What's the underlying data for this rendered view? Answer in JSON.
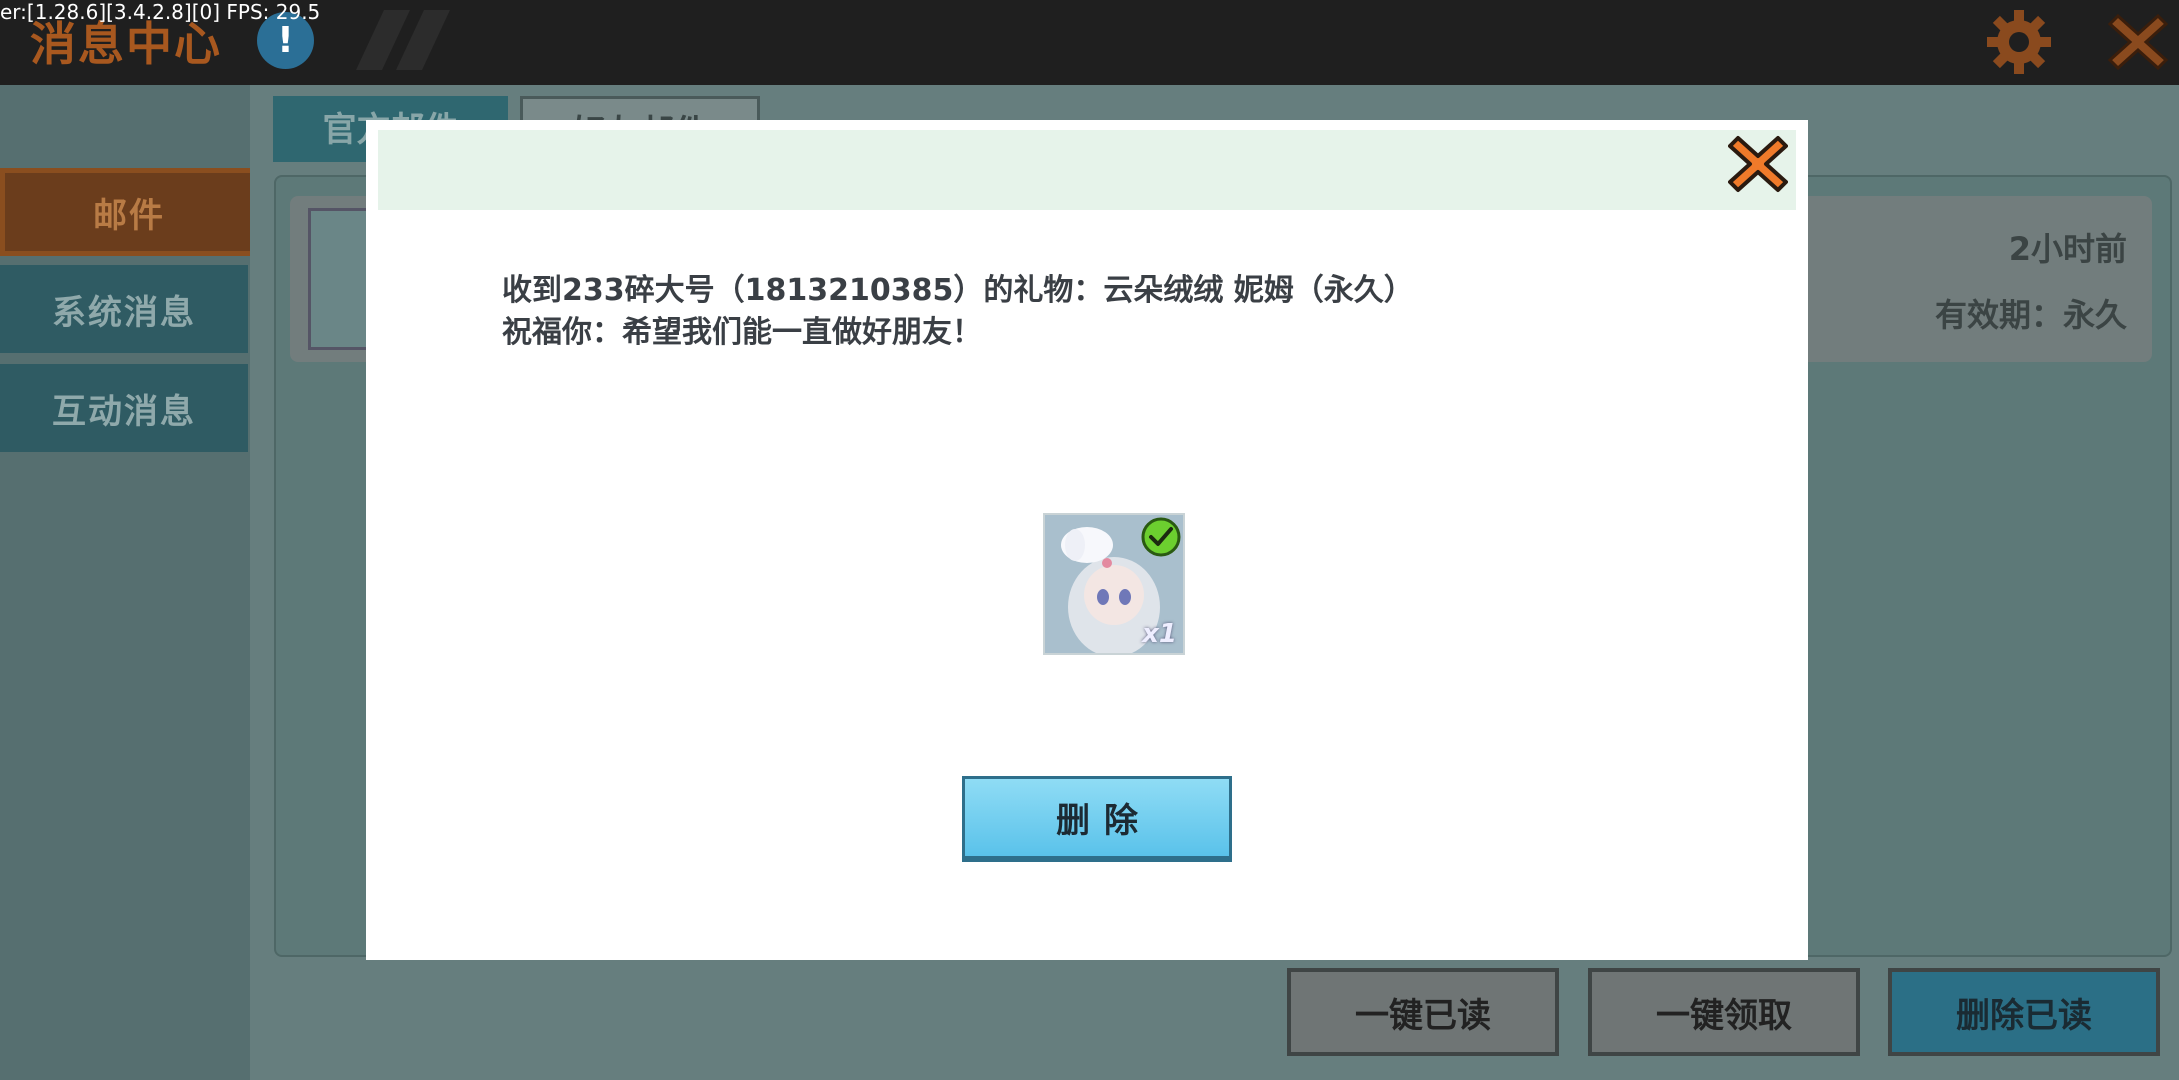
{
  "debug": "er:[1.28.6][3.4.2.8][0] FPS: 29.5",
  "app": {
    "title": "消息中心",
    "info_badge": "!"
  },
  "sidebar": {
    "items": [
      {
        "label": "邮件"
      },
      {
        "label": "系统消息"
      },
      {
        "label": "互动消息"
      }
    ]
  },
  "tabs": [
    {
      "label": "官方邮件"
    },
    {
      "label": "好友邮件"
    }
  ],
  "mail": {
    "time": "2小时前",
    "expiry": "有效期：永久"
  },
  "bottom_buttons": {
    "read_all": "一键已读",
    "claim_all": "一键领取",
    "delete_read": "删除已读"
  },
  "modal": {
    "line1": "收到233碎大号（1813210385）的礼物：云朵绒绒 妮姆（永久）",
    "line2": "祝福你：希望我们能一直做好朋友！",
    "gift_count": "x1",
    "delete_label": "删除"
  },
  "colors": {
    "accent_orange": "#f07a2a",
    "button_blue": "#5ac2ea",
    "header_green": "#e6f3ea"
  },
  "icons": {
    "settings": "gear-icon",
    "close": "close-icon",
    "check": "check-icon"
  }
}
